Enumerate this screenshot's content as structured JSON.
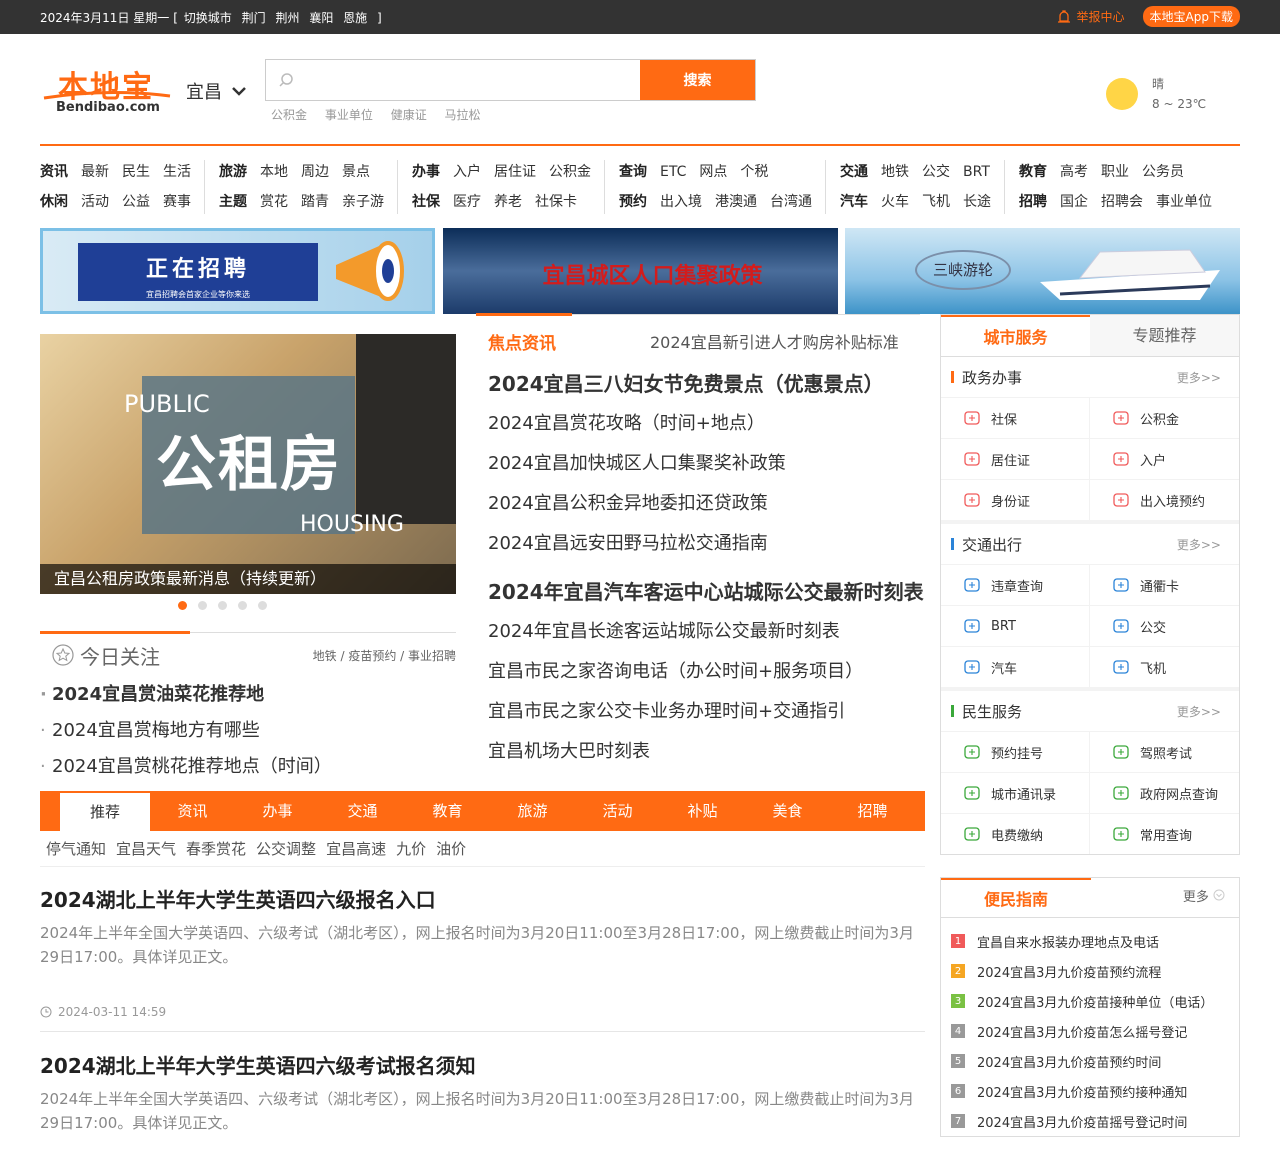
{
  "topbar": {
    "date": "2024年3月11日 星期一",
    "bracket_open": "[",
    "switch": "切换城市",
    "cities": [
      "荆门",
      "荆州",
      "襄阳",
      "恩施"
    ],
    "bracket_close": "]",
    "report": "举报中心",
    "app": "本地宝App下载"
  },
  "header": {
    "logo_cn": "本地宝",
    "logo_en": "Bendibao.com",
    "city": "宜昌",
    "search_btn": "搜索",
    "hotwords": [
      "公积金",
      "事业单位",
      "健康证",
      "马拉松"
    ],
    "weather": {
      "cond": "晴",
      "temp": "8 ~ 23℃"
    }
  },
  "nav": [
    [
      [
        "资讯",
        "最新",
        "民生",
        "生活"
      ],
      [
        "休闲",
        "活动",
        "公益",
        "赛事"
      ]
    ],
    [
      [
        "旅游",
        "本地",
        "周边",
        "景点"
      ],
      [
        "主题",
        "赏花",
        "踏青",
        "亲子游"
      ]
    ],
    [
      [
        "办事",
        "入户",
        "居住证",
        "公积金"
      ],
      [
        "社保",
        "医疗",
        "养老",
        "社保卡"
      ]
    ],
    [
      [
        "查询",
        "ETC",
        "网点",
        "个税"
      ],
      [
        "预约",
        "出入境",
        "港澳通",
        "台湾通"
      ]
    ],
    [
      [
        "交通",
        "地铁",
        "公交",
        "BRT"
      ],
      [
        "汽车",
        "火车",
        "飞机",
        "长途"
      ]
    ],
    [
      [
        "教育",
        "高考",
        "职业",
        "公务员"
      ],
      [
        "招聘",
        "国企",
        "招聘会",
        "事业单位"
      ]
    ]
  ],
  "banners": {
    "b1": "正在招聘",
    "b1_sub": "宜昌招聘会首家企业等你来选",
    "b2": "宜昌城区人口集聚政策",
    "b3": "三峡游轮"
  },
  "slider": {
    "pub": "PUBLIC",
    "gz": "公租房",
    "hou": "HOUSING",
    "caption": "宜昌公租房政策最新消息（持续更新）"
  },
  "today": {
    "title": "今日关注",
    "links": "地铁 / 疫苗预约 / 事业招聘",
    "items": [
      "2024宜昌赏油菜花推荐地",
      "2024宜昌赏梅地方有哪些",
      "2024宜昌赏桃花推荐地点（时间）"
    ]
  },
  "focus": {
    "title": "焦点资讯",
    "right": "2024宜昌新引进人才购房补贴标准",
    "items": [
      "2024宜昌三八妇女节免费景点（优惠景点）",
      "2024宜昌赏花攻略（时间+地点）",
      "2024宜昌加快城区人口集聚奖补政策",
      "2024宜昌公积金异地委扣还贷政策",
      "2024宜昌远安田野马拉松交通指南",
      "2024年宜昌汽车客运中心站城际公交最新时刻表",
      "2024年宜昌长途客运站城际公交最新时刻表",
      "宜昌市民之家咨询电话（办公时间+服务项目）",
      "宜昌市民之家公交卡业务办理时间+交通指引",
      "宜昌机场大巴时刻表"
    ]
  },
  "sidebar": {
    "tab1": "城市服务",
    "tab2": "专题推荐",
    "more": "更多>>",
    "sec1": {
      "title": "政务办事",
      "items": [
        "社保",
        "公积金",
        "居住证",
        "入户",
        "身份证",
        "出入境预约"
      ]
    },
    "sec2": {
      "title": "交通出行",
      "items": [
        "违章查询",
        "通衢卡",
        "BRT",
        "公交",
        "汽车",
        "飞机"
      ]
    },
    "sec3": {
      "title": "民生服务",
      "items": [
        "预约挂号",
        "驾照考试",
        "城市通讯录",
        "政府网点查询",
        "电费缴纳",
        "常用查询"
      ]
    }
  },
  "guide": {
    "title": "便民指南",
    "more": "更多",
    "items": [
      "宜昌自来水报装办理地点及电话",
      "2024宜昌3月九价疫苗预约流程",
      "2024宜昌3月九价疫苗接种单位（电话）",
      "2024宜昌3月九价疫苗怎么摇号登记",
      "2024宜昌3月九价疫苗预约时间",
      "2024宜昌3月九价疫苗预约接种通知",
      "2024宜昌3月九价疫苗摇号登记时间"
    ],
    "nums": [
      "1",
      "2",
      "3",
      "4",
      "5",
      "6",
      "7"
    ],
    "colors": [
      "#f05a5a",
      "#f5a623",
      "#7ac143",
      "#999999",
      "#999999",
      "#999999",
      "#999999"
    ]
  },
  "tabs": [
    "推荐",
    "资讯",
    "办事",
    "交通",
    "教育",
    "旅游",
    "活动",
    "补贴",
    "美食",
    "招聘"
  ],
  "tags": [
    "停气通知",
    "宜昌天气",
    "春季赏花",
    "公交调整",
    "宜昌高速",
    "九价",
    "油价"
  ],
  "articles": [
    {
      "title": "2024湖北上半年大学生英语四六级报名入口",
      "desc": "2024年上半年全国大学英语四、六级考试（湖北考区），网上报名时间为3月20日11:00至3月28日17:00，网上缴费截止时间为3月29日17:00。具体详见正文。",
      "time": "2024-03-11 14:59"
    },
    {
      "title": "2024湖北上半年大学生英语四六级考试报名须知",
      "desc": "2024年上半年全国大学英语四、六级考试（湖北考区），网上报名时间为3月20日11:00至3月28日17:00，网上缴费截止时间为3月29日17:00。具体详见正文。"
    }
  ]
}
